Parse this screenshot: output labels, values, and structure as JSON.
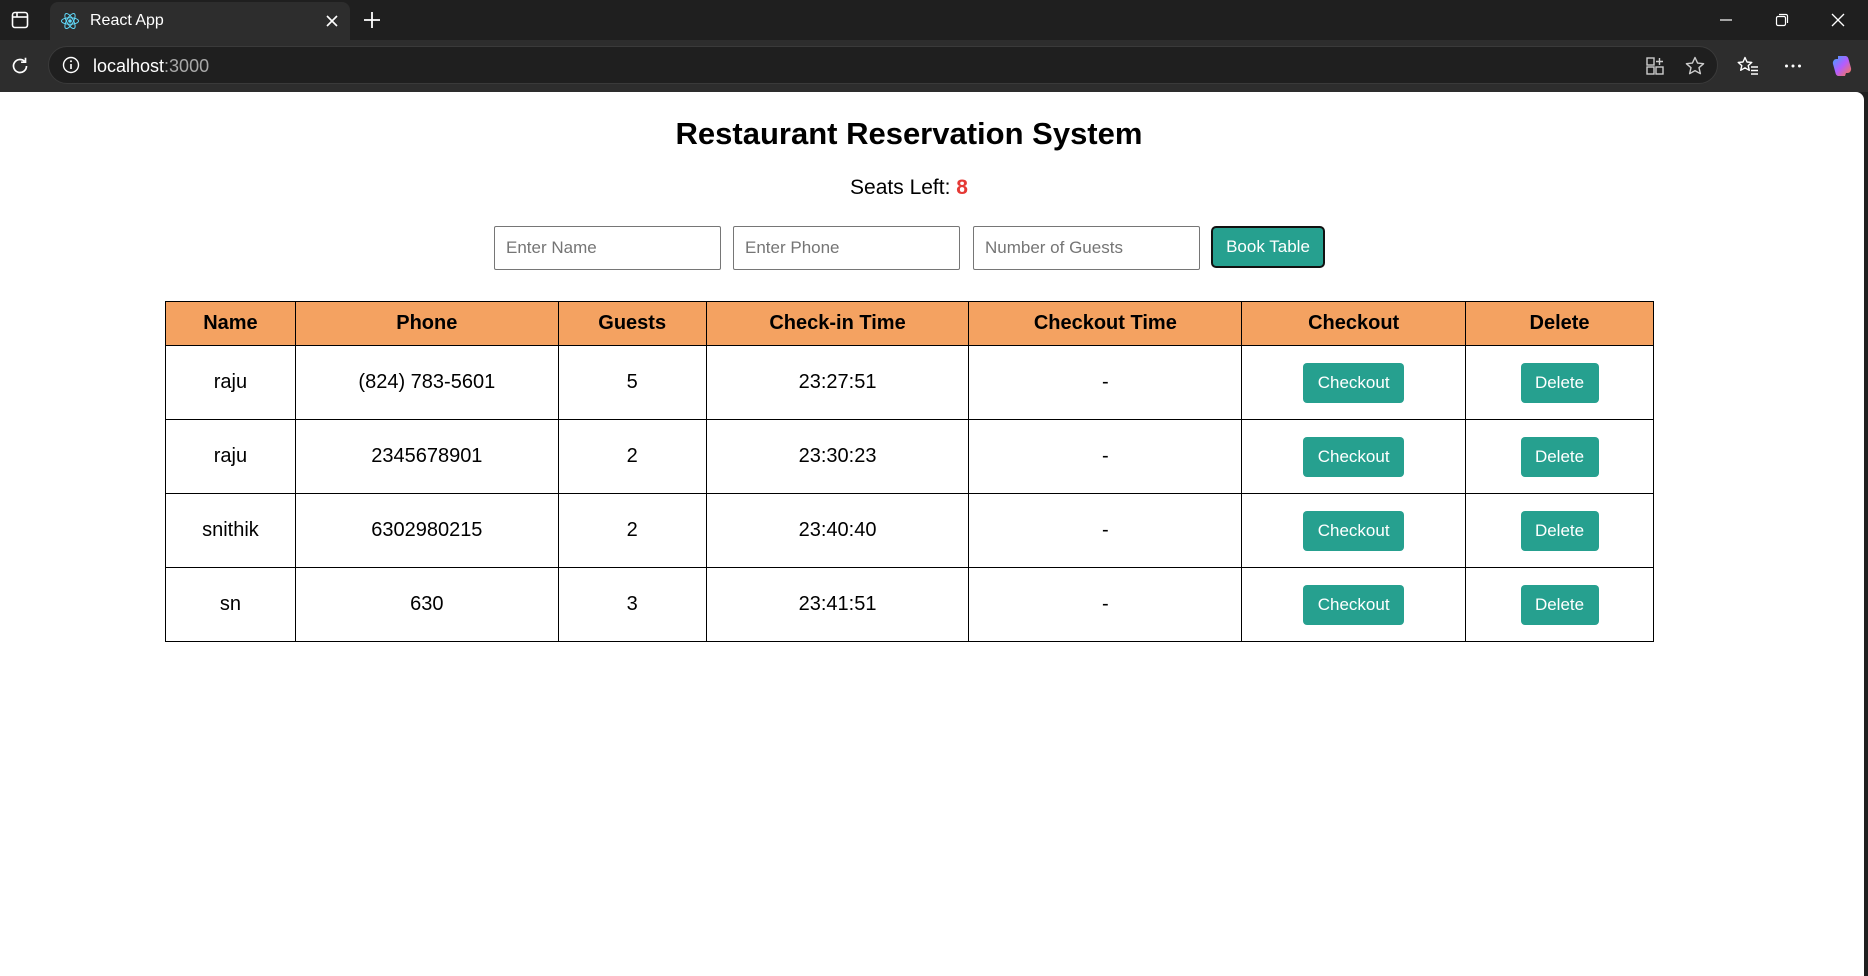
{
  "browser": {
    "tab_title": "React App",
    "url_host": "localhost",
    "url_port": ":3000"
  },
  "page": {
    "title": "Restaurant Reservation System",
    "seats_label": "Seats Left:",
    "seats_count": "8",
    "form": {
      "name_placeholder": "Enter Name",
      "phone_placeholder": "Enter Phone",
      "guests_placeholder": "Number of Guests",
      "book_label": "Book Table"
    },
    "table": {
      "headers": [
        "Name",
        "Phone",
        "Guests",
        "Check-in Time",
        "Checkout Time",
        "Checkout",
        "Delete"
      ],
      "rows": [
        {
          "name": "raju",
          "phone": "(824) 783-5601",
          "guests": "5",
          "checkin": "23:27:51",
          "checkout": "-"
        },
        {
          "name": "raju",
          "phone": "2345678901",
          "guests": "2",
          "checkin": "23:30:23",
          "checkout": "-"
        },
        {
          "name": "snithik",
          "phone": "6302980215",
          "guests": "2",
          "checkin": "23:40:40",
          "checkout": "-"
        },
        {
          "name": "sn",
          "phone": "630",
          "guests": "3",
          "checkin": "23:41:51",
          "checkout": "-"
        }
      ],
      "checkout_button": "Checkout",
      "delete_button": "Delete"
    }
  },
  "colors": {
    "header_bg": "#f4a261",
    "button_bg": "#26a08f",
    "seats_accent": "#e53935"
  }
}
